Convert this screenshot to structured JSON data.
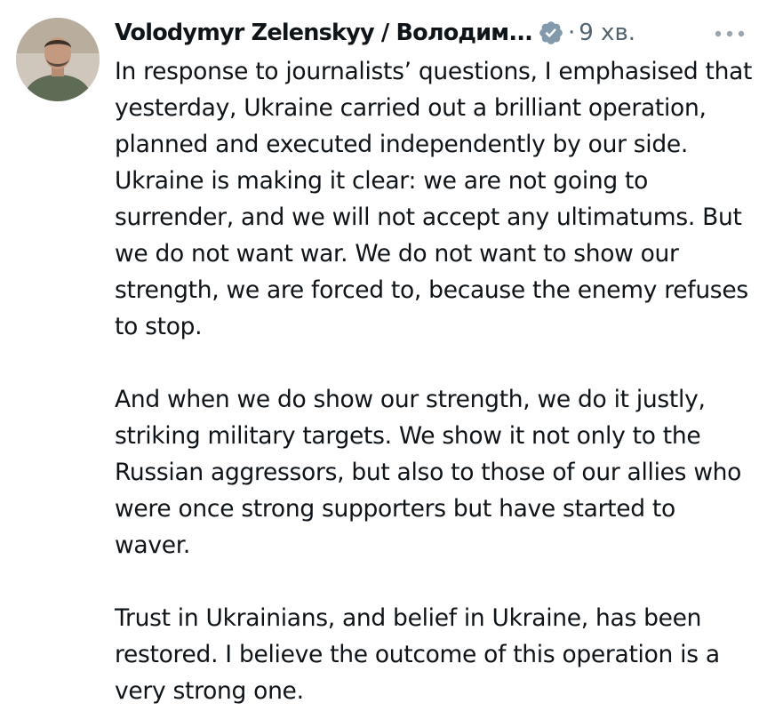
{
  "post": {
    "author_name": "Volodymyr Zelenskyy / Володим...",
    "separator": "·",
    "time": "9 хв.",
    "more_icon": "more-horizontal-icon",
    "verified_icon": "verified-badge-icon",
    "paragraphs": [
      "In response to journalists’ questions, I emphasised that yesterday, Ukraine carried out a brilliant operation, planned and executed independently by our side. Ukraine is making it clear: we are not going to surrender, and we will not accept any ultimatums. But we do not want war. We do not want to show our strength, we are forced to, because the enemy refuses to stop.",
      "And when we do show our strength, we do it justly, striking military targets. We show it not only to the Russian aggressors, but also to those of our allies who were once strong supporters but have started to waver.",
      "Trust in Ukrainians, and belief in Ukraine, has been restored. I believe the outcome of this operation is a very strong one."
    ]
  },
  "colors": {
    "text": "#0f1419",
    "secondary": "#536471",
    "verified": "#829aab",
    "background": "#ffffff"
  }
}
